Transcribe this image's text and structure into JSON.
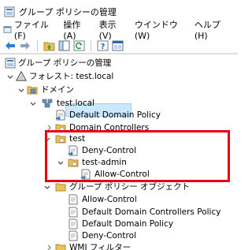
{
  "window": {
    "title": "グループ ポリシーの管理"
  },
  "menubar": {
    "items": [
      {
        "label": "ファイル(F)"
      },
      {
        "label": "操作(A)"
      },
      {
        "label": "表示(V)"
      },
      {
        "label": "ウインドウ(W)"
      },
      {
        "label": "ヘルプ(H)"
      }
    ]
  },
  "toolbar": {
    "buttons": [
      "back-arrow-icon",
      "forward-arrow-icon",
      "up-folder-icon",
      "show-tree-icon",
      "refresh-icon",
      "help-icon",
      "properties-icon"
    ]
  },
  "tree": {
    "root": "グループ ポリシーの管理",
    "forest": "フォレスト: test.local",
    "domains": "ドメイン",
    "domain": "test.local",
    "default_domain_policy": "Default Domain Policy",
    "domain_controllers": "Domain Controllers",
    "ou_test": "test",
    "deny_control": "Deny-Control",
    "ou_test_admin": "test-admin",
    "allow_control": "Allow-Control",
    "gpo_folder": "グループ ポリシー オブジェクト",
    "gpo_items": [
      "Allow-Control",
      "Default Domain Controllers Policy",
      "Default Domain Policy",
      "Deny-Control"
    ],
    "wmi_filter": "WMI フィルター"
  },
  "colors": {
    "highlight_border": "#e60012",
    "selection": "#cce8ff"
  }
}
